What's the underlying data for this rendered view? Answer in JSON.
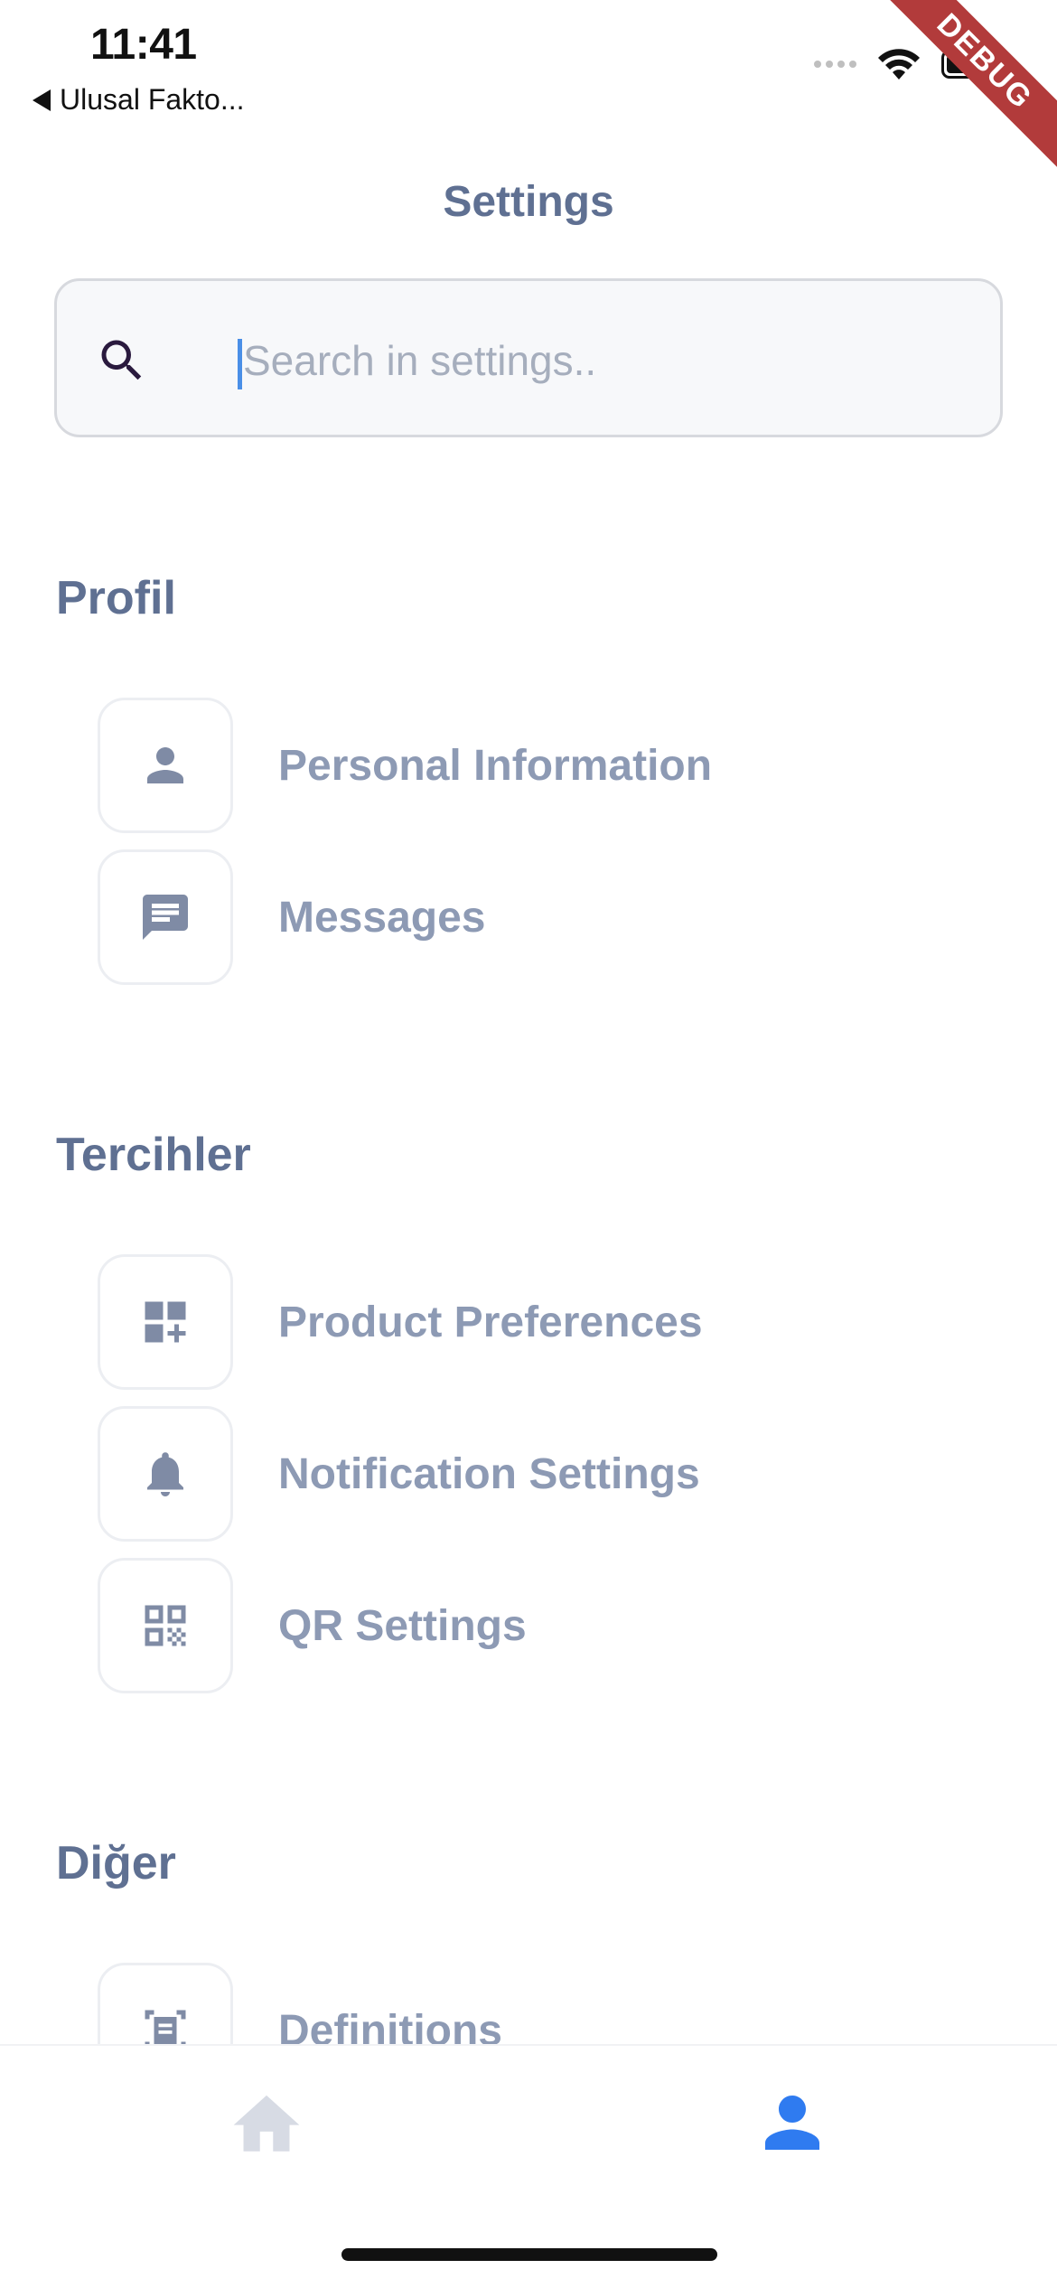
{
  "status_bar": {
    "time": "11:41",
    "back_app": "Ulusal Fakto..."
  },
  "debug_banner": "DEBUG",
  "header": {
    "title": "Settings"
  },
  "search": {
    "placeholder": "Search in settings..",
    "value": ""
  },
  "sections": [
    {
      "title": "Profil",
      "items": [
        {
          "label": "Personal Information",
          "icon": "person-icon"
        },
        {
          "label": "Messages",
          "icon": "message-icon"
        }
      ]
    },
    {
      "title": "Tercihler",
      "items": [
        {
          "label": "Product Preferences",
          "icon": "dashboard-add-icon"
        },
        {
          "label": "Notification Settings",
          "icon": "bell-icon"
        },
        {
          "label": "QR Settings",
          "icon": "qr-code-icon"
        }
      ]
    },
    {
      "title": "Diğer",
      "items": [
        {
          "label": "Definitions",
          "icon": "document-scanner-icon"
        }
      ]
    }
  ],
  "bottom_nav": {
    "items": [
      {
        "icon": "home-icon",
        "active": false
      },
      {
        "icon": "profile-icon",
        "active": true
      }
    ]
  },
  "colors": {
    "accent": "#2f7bf0",
    "icon_gray": "#7f8ba5",
    "inactive_nav": "#d7dbe4",
    "title_text": "#5f7092",
    "item_text": "#8d9ab4",
    "debug_red": "#b23b3b"
  }
}
